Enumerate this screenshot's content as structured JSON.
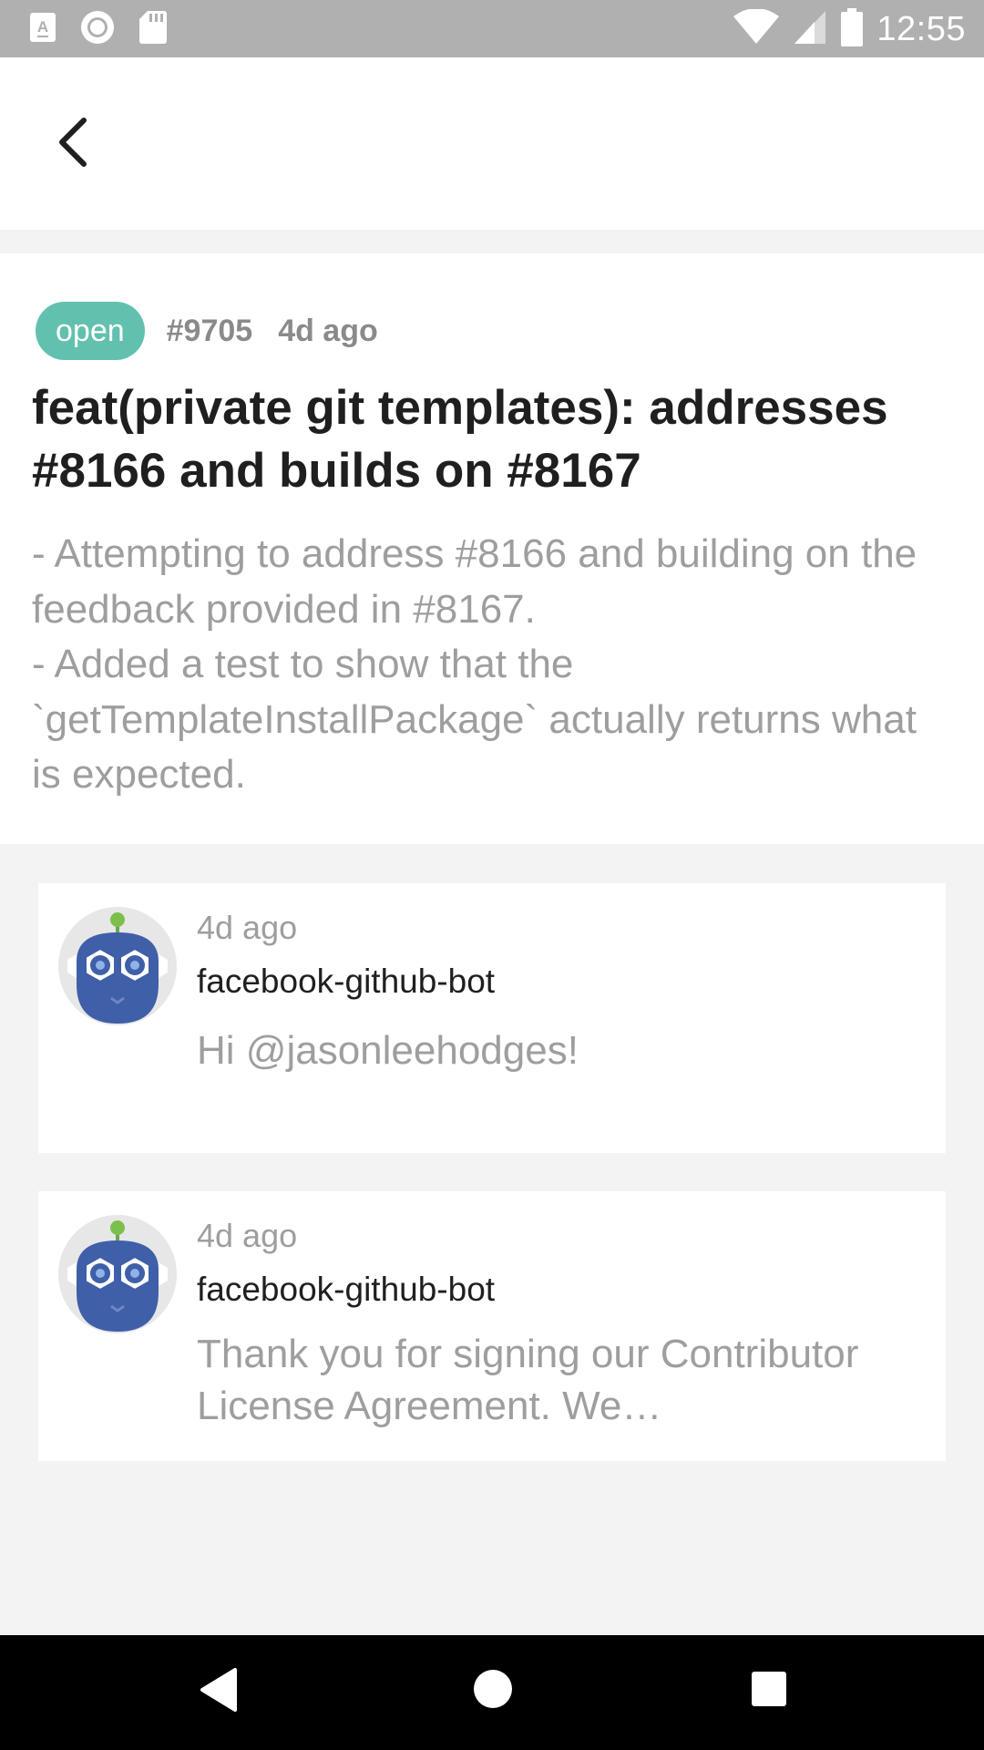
{
  "status_bar": {
    "time": "12:55",
    "left_icons": [
      "a-badge-icon",
      "circle-notification-icon",
      "sd-card-icon"
    ],
    "right_icons": [
      "wifi-icon",
      "cell-signal-icon",
      "battery-icon"
    ]
  },
  "header": {
    "back_icon": "chevron-left-icon"
  },
  "pull_request": {
    "status": "open",
    "status_color": "#62c1ae",
    "number": "#9705",
    "time": "4d ago",
    "title": "feat(private git templates): addresses #8166 and builds on #8167",
    "body": "- Attempting to address #8166 and building on the feedback provided in #8167.\n- Added a test to show that the `getTemplateInstallPackage` actually returns what is expected."
  },
  "comments": [
    {
      "time": "4d ago",
      "author": "facebook-github-bot",
      "text": "Hi @jasonleehodges!",
      "avatar_icon": "bot-avatar-icon"
    },
    {
      "time": "4d ago",
      "author": "facebook-github-bot",
      "text": "Thank you for signing our Contributor License Agreement. We…",
      "avatar_icon": "bot-avatar-icon"
    }
  ],
  "nav_bar": {
    "icons": [
      "nav-back-icon",
      "nav-home-icon",
      "nav-recents-icon"
    ]
  }
}
